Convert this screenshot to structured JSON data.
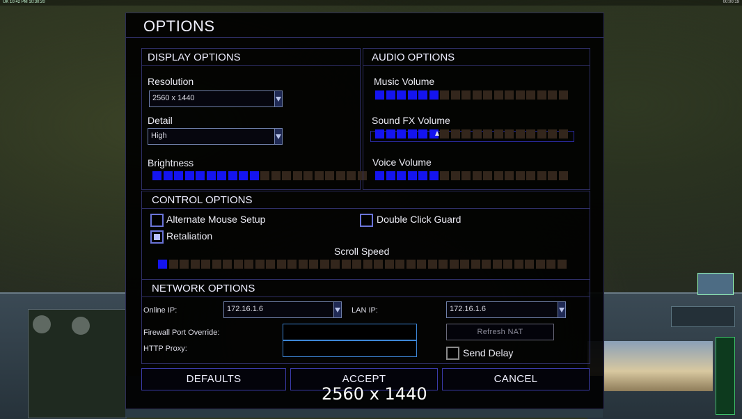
{
  "topbar": {
    "left_text": "UK 10:42 PM 10:30:20",
    "right_text": "00:00:19"
  },
  "dialog": {
    "title": "OPTIONS"
  },
  "display": {
    "heading": "DISPLAY OPTIONS",
    "resolution_label": "Resolution",
    "resolution_value": "2560 x 1440",
    "detail_label": "Detail",
    "detail_value": "High",
    "brightness_label": "Brightness",
    "brightness_level": {
      "filled": 10,
      "total": 20
    }
  },
  "audio": {
    "heading": "AUDIO OPTIONS",
    "music_label": "Music Volume",
    "music_level": {
      "filled": 6,
      "total": 18
    },
    "sfx_label": "Sound FX Volume",
    "sfx_level": {
      "filled": 6,
      "total": 18
    },
    "voice_label": "Voice Volume",
    "voice_level": {
      "filled": 6,
      "total": 18
    }
  },
  "control": {
    "heading": "CONTROL OPTIONS",
    "alt_mouse_label": "Alternate Mouse Setup",
    "alt_mouse_checked": false,
    "double_click_label": "Double Click Guard",
    "double_click_checked": false,
    "retaliation_label": "Retaliation",
    "retaliation_checked": true,
    "scroll_label": "Scroll Speed",
    "scroll_level": {
      "filled": 1,
      "total": 38
    }
  },
  "network": {
    "heading": "NETWORK OPTIONS",
    "online_ip_label": "Online IP:",
    "online_ip_value": "172.16.1.6",
    "lan_ip_label": "LAN IP:",
    "lan_ip_value": "172.16.1.6",
    "firewall_label": "Firewall Port Override:",
    "firewall_value": "",
    "http_proxy_label": "HTTP Proxy:",
    "http_proxy_value": "",
    "refresh_nat_label": "Refresh NAT",
    "send_delay_label": "Send Delay",
    "send_delay_checked": false
  },
  "buttons": {
    "defaults": "DEFAULTS",
    "accept": "ACCEPT",
    "cancel": "CANCEL"
  },
  "overlay_caption": "2560 x 1440",
  "colors": {
    "slider_on": "#1414f0",
    "slider_off": "#33261c",
    "border": "#2f2f66",
    "field_border": "#3d86d6"
  }
}
